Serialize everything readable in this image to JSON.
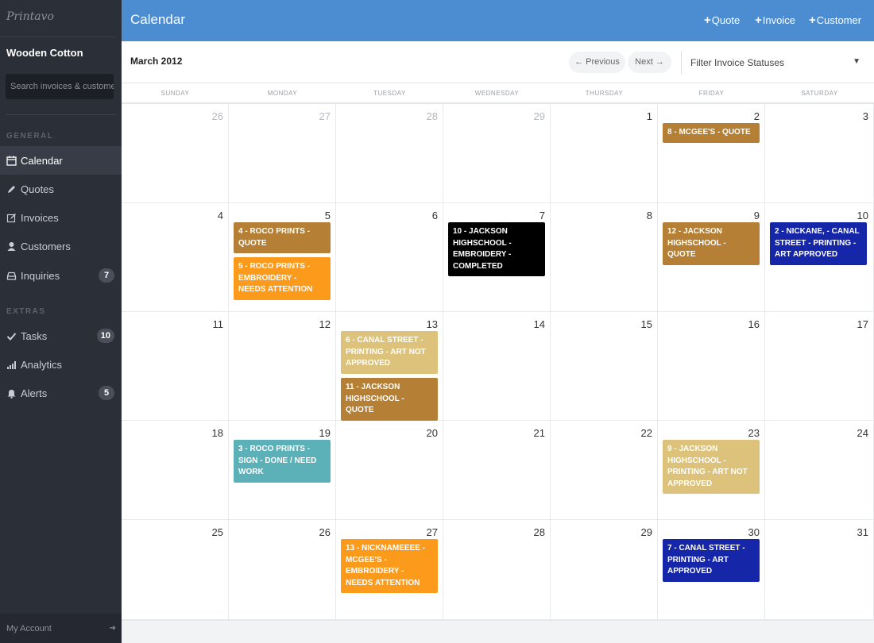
{
  "app": {
    "logo": "Printavo",
    "account_name": "Wooden Cotton"
  },
  "search": {
    "placeholder": "Search invoices & customers..."
  },
  "sidebar": {
    "general_heading": "GENERAL",
    "extras_heading": "EXTRAS",
    "items": [
      {
        "label": "Calendar",
        "icon": "calendar-icon",
        "active": true
      },
      {
        "label": "Quotes",
        "icon": "pencil-icon"
      },
      {
        "label": "Invoices",
        "icon": "edit-icon"
      },
      {
        "label": "Customers",
        "icon": "user-icon"
      },
      {
        "label": "Inquiries",
        "icon": "inbox-icon",
        "badge": "7"
      },
      {
        "label": "Tasks",
        "icon": "check-icon",
        "badge": "10"
      },
      {
        "label": "Analytics",
        "icon": "bar-chart-icon"
      },
      {
        "label": "Alerts",
        "icon": "bell-icon",
        "badge": "5"
      }
    ],
    "my_account": "My Account"
  },
  "header": {
    "title": "Calendar",
    "quote_btn": "Quote",
    "invoice_btn": "Invoice",
    "customer_btn": "Customer"
  },
  "calendar": {
    "month": "March 2012",
    "prev": "← Previous",
    "next": "Next →",
    "filter": "Filter Invoice Statuses",
    "weekdays": [
      "SUNDAY",
      "MONDAY",
      "TUESDAY",
      "WEDNESDAY",
      "THURSDAY",
      "FRIDAY",
      "SATURDAY"
    ],
    "weeks": [
      [
        {
          "day": "26",
          "muted": true
        },
        {
          "day": "27",
          "muted": true
        },
        {
          "day": "28",
          "muted": true
        },
        {
          "day": "29",
          "muted": true
        },
        {
          "day": "1"
        },
        {
          "day": "2"
        },
        {
          "day": "3"
        }
      ],
      [
        {
          "day": "4"
        },
        {
          "day": "5"
        },
        {
          "day": "6"
        },
        {
          "day": "7"
        },
        {
          "day": "8"
        },
        {
          "day": "9"
        },
        {
          "day": "10"
        }
      ],
      [
        {
          "day": "11"
        },
        {
          "day": "12"
        },
        {
          "day": "13"
        },
        {
          "day": "14"
        },
        {
          "day": "15"
        },
        {
          "day": "16"
        },
        {
          "day": "17"
        }
      ],
      [
        {
          "day": "18"
        },
        {
          "day": "19"
        },
        {
          "day": "20"
        },
        {
          "day": "21"
        },
        {
          "day": "22"
        },
        {
          "day": "23"
        },
        {
          "day": "24"
        }
      ],
      [
        {
          "day": "25"
        },
        {
          "day": "26"
        },
        {
          "day": "27"
        },
        {
          "day": "28"
        },
        {
          "day": "29"
        },
        {
          "day": "30"
        },
        {
          "day": "31"
        }
      ]
    ],
    "events": [
      {
        "week": 0,
        "dow": 5,
        "order": 0,
        "text": "8 - MCGEE'S - QUOTE",
        "color": "#b58035"
      },
      {
        "week": 1,
        "dow": 1,
        "order": 0,
        "text": "4 - ROCO PRINTS - QUOTE",
        "color": "#b58035"
      },
      {
        "week": 1,
        "dow": 1,
        "order": 1,
        "text": "5 - ROCO PRINTS - EMBROIDERY - NEEDS ATTENTION",
        "color": "#fc9a1c"
      },
      {
        "week": 1,
        "dow": 3,
        "order": 0,
        "text": "10 - JACKSON HIGHSCHOOL - EMBROIDERY - COMPLETED",
        "color": "#000000"
      },
      {
        "week": 1,
        "dow": 5,
        "order": 0,
        "text": "12 - JACKSON HIGHSCHOOL - QUOTE",
        "color": "#b58035"
      },
      {
        "week": 1,
        "dow": 6,
        "order": 0,
        "text": "2 - NICKANE, - CANAL STREET - PRINTING - ART APPROVED",
        "color": "#1626a8"
      },
      {
        "week": 2,
        "dow": 2,
        "order": 0,
        "text": "6 - CANAL STREET - PRINTING - ART NOT APPROVED",
        "color": "#dcc27b"
      },
      {
        "week": 2,
        "dow": 2,
        "order": 1,
        "text": "11 - JACKSON HIGHSCHOOL - QUOTE",
        "color": "#b58035"
      },
      {
        "week": 3,
        "dow": 1,
        "order": 0,
        "text": "3 - ROCO PRINTS - SIGN - DONE / NEED WORK",
        "color": "#5cb0b8"
      },
      {
        "week": 3,
        "dow": 5,
        "order": 0,
        "text": "9 - JACKSON HIGHSCHOOL - PRINTING - ART NOT APPROVED",
        "color": "#dcc27b"
      },
      {
        "week": 4,
        "dow": 2,
        "order": 0,
        "text": "13 - NICKNAMEEEE - MCGEE'S - EMBROIDERY - NEEDS ATTENTION",
        "color": "#fc9a1c"
      },
      {
        "week": 4,
        "dow": 5,
        "order": 0,
        "text": "7 - CANAL STREET - PRINTING - ART APPROVED",
        "color": "#1626a8"
      }
    ]
  }
}
